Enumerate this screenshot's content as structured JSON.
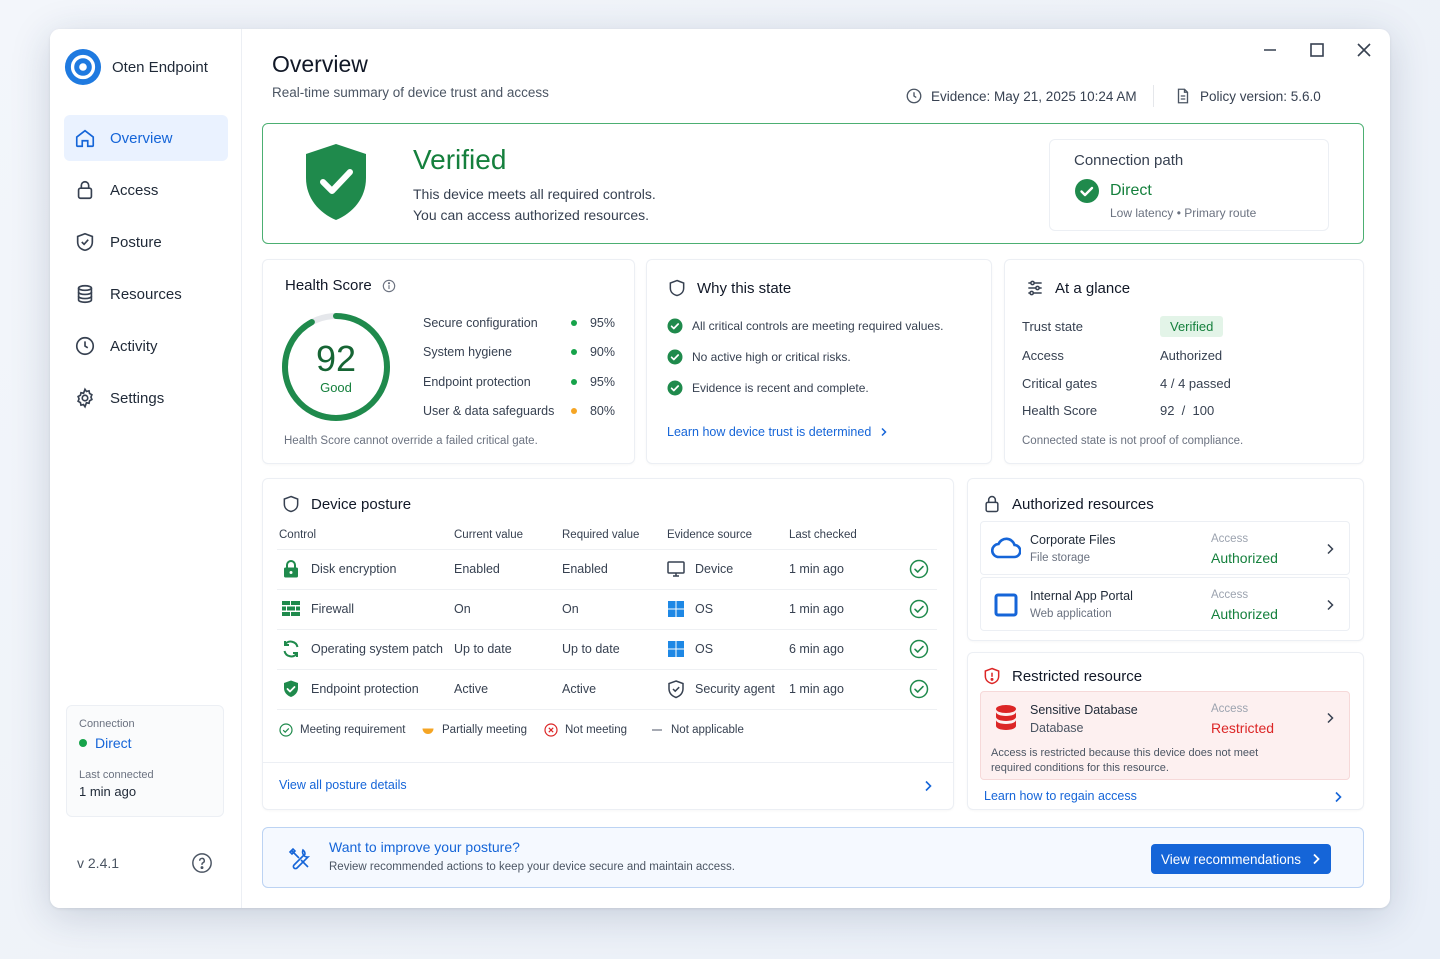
{
  "app": {
    "name": "Oten Endpoint",
    "version": "v 2.4.1"
  },
  "nav": [
    {
      "label": "Overview",
      "icon": "home-icon",
      "active": true
    },
    {
      "label": "Access",
      "icon": "lock-icon"
    },
    {
      "label": "Posture",
      "icon": "shield-check-icon"
    },
    {
      "label": "Resources",
      "icon": "database-icon"
    },
    {
      "label": "Activity",
      "icon": "clock-icon"
    },
    {
      "label": "Settings",
      "icon": "gear-icon"
    }
  ],
  "sidebar_connection": {
    "label": "Connection",
    "value": "Direct",
    "last_label": "Last connected",
    "last_value": "1 min ago"
  },
  "header": {
    "title": "Overview",
    "subtitle": "Real-time summary of device trust and access",
    "evidence": "Evidence: May 21, 2025 10:24 AM",
    "policy": "Policy version: 5.6.0"
  },
  "banner": {
    "title": "Verified",
    "line1": "This device meets all required controls.",
    "line2": "You can access authorized resources.",
    "connection_title": "Connection path",
    "connection_value": "Direct",
    "connection_sub": "Low latency  •  Primary route",
    "accent": "#15803d"
  },
  "health": {
    "title": "Health Score",
    "score": 92,
    "score_label": "Good",
    "items": [
      {
        "name": "Secure configuration",
        "pct": "95%",
        "status": "green"
      },
      {
        "name": "System hygiene",
        "pct": "90%",
        "status": "green"
      },
      {
        "name": "Endpoint protection",
        "pct": "95%",
        "status": "green"
      },
      {
        "name": "User & data safeguards",
        "pct": "80%",
        "status": "amber"
      }
    ],
    "note": "Health Score cannot override a failed critical gate."
  },
  "why": {
    "title": "Why this state",
    "items": [
      "All critical controls are meeting required values.",
      "No active high or critical risks.",
      "Evidence is recent and complete."
    ],
    "link": "Learn how device trust is determined"
  },
  "glance": {
    "title": "At a glance",
    "rows": [
      {
        "k": "Trust state",
        "v": "Verified"
      },
      {
        "k": "Access",
        "v": "Authorized"
      },
      {
        "k": "Critical gates",
        "v": "4 / 4 passed"
      },
      {
        "k": "Health Score",
        "v": "92  /  100"
      }
    ],
    "note": "Connected state is not proof of compliance."
  },
  "posture": {
    "title": "Device posture",
    "headers": [
      "Control",
      "Current value",
      "Required value",
      "Evidence source",
      "Last checked"
    ],
    "rows": [
      {
        "control": "Disk encryption",
        "current": "Enabled",
        "required": "Enabled",
        "source": "Device",
        "checked": "1 min ago",
        "icon": "lock-icon",
        "source_icon": "monitor-icon"
      },
      {
        "control": "Firewall",
        "current": "On",
        "required": "On",
        "source": "OS",
        "checked": "1 min ago",
        "icon": "firewall-icon",
        "source_icon": "windows-icon"
      },
      {
        "control": "Operating system patch",
        "current": "Up to date",
        "required": "Up to date",
        "source": "OS",
        "checked": "6 min ago",
        "icon": "refresh-icon",
        "source_icon": "windows-icon"
      },
      {
        "control": "Endpoint protection",
        "current": "Active",
        "required": "Active",
        "source": "Security agent",
        "checked": "1 min ago",
        "icon": "shield-icon",
        "source_icon": "shield-outline-icon"
      }
    ],
    "legend": [
      "Meeting requirement",
      "Partially meeting",
      "Not meeting",
      "Not applicable"
    ],
    "link": "View all posture details"
  },
  "authorized": {
    "title": "Authorized resources",
    "items": [
      {
        "name": "Corporate Files",
        "type": "File storage",
        "access_label": "Access",
        "access": "Authorized"
      },
      {
        "name": "Internal App Portal",
        "type": "Web application",
        "access_label": "Access",
        "access": "Authorized"
      }
    ]
  },
  "restricted": {
    "title": "Restricted resource",
    "name": "Sensitive Database",
    "type": "Database",
    "access_label": "Access",
    "access": "Restricted",
    "note1": "Access is restricted because this device does not meet",
    "note2": "required conditions for this resource.",
    "link": "Learn how to regain access"
  },
  "improve": {
    "title": "Want to improve your posture?",
    "text": "Review recommended actions to keep your device secure and maintain access.",
    "button": "View recommendations"
  }
}
